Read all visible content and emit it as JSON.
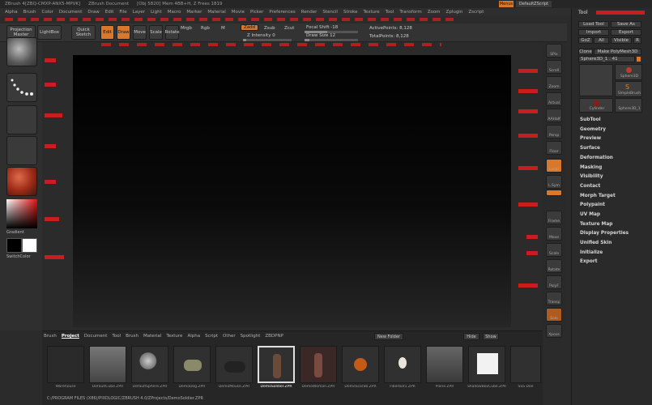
{
  "titlebar": {
    "items": [
      "ZBrush 4[ZBQ-CMXP-ANX5-MPVK]",
      "ZBrush Document",
      "[Obj 5820] Mem 4BB+H, Z Frees 1819"
    ],
    "right": [
      "Menus",
      "DefaultZScript"
    ]
  },
  "menubar": {
    "items": [
      "Alpha",
      "Brush",
      "Color",
      "Document",
      "Draw",
      "Edit",
      "File",
      "Layer",
      "Light",
      "Macro",
      "Marker",
      "Material",
      "Movie",
      "Picker",
      "Preferences",
      "Render",
      "Stencil",
      "Stroke",
      "Texture",
      "Tool",
      "Transform",
      "Zoom",
      "Zplugin",
      "Zscript"
    ]
  },
  "toolbar": {
    "projection_master": "Projection Master",
    "lightbox": "LightBox",
    "quick_sketch": "Quick Sketch",
    "edit": "Edit",
    "draw": "Draw",
    "move": "Move",
    "scale": "Scale",
    "rotate": "Rotate",
    "mrgb": "Mrgb",
    "rgb": "Rgb",
    "m": "M",
    "zadd": "Zadd",
    "zsub": "Zsub",
    "zcut": "Zcut",
    "z_intensity": "Z Intensity 0",
    "focal_shift": "Focal Shift -18",
    "draw_size": "Draw Size 12",
    "active_points": "ActivePoints: 8,128",
    "total_points": "TotalPoints: 8,128"
  },
  "tool_panel": {
    "header": "Tool",
    "buttons": {
      "load_tool": "Load Tool",
      "save_as": "Save As",
      "import": "Import",
      "export": "Export",
      "goz": "GoZ",
      "all": "All",
      "visible": "Visible",
      "r": "R"
    },
    "clone": "Clone",
    "make": "Make PolyMesh3D",
    "current_tool": "Sphere3D_1 . 41",
    "subtools": [
      "Sphere3D",
      "SimpleBrush",
      "Cylinder",
      "Sphere3D_1"
    ],
    "menu": [
      "SubTool",
      "Geometry",
      "Preview",
      "Surface",
      "Deformation",
      "Masking",
      "Visibility",
      "Contact",
      "Morph Target",
      "Polypaint",
      "UV Map",
      "Texture Map",
      "Display Properties",
      "Unified Skin",
      "Initialize",
      "Export"
    ]
  },
  "left_shelf": {
    "gradient": "Gradient",
    "switch_color": "SwitchColor"
  },
  "right_shelf": [
    "SPix",
    "Scroll",
    "Zoom",
    "Actual",
    "AAHalf",
    "Persp",
    "Floor",
    "Local",
    "L.Sym",
    "Frame",
    "Move",
    "Scale",
    "Rotate",
    "PolyF",
    "Transp",
    "Solo",
    "Xpose"
  ],
  "lightbox": {
    "tabs": [
      "Brush",
      "Project",
      "Document",
      "Tool",
      "Brush",
      "Material",
      "Texture",
      "Alpha",
      "Script",
      "Other",
      "Spotlight",
      "ZBDPNP"
    ],
    "new_folder": "New Folder",
    "tools": [
      "Hide",
      "Show"
    ],
    "items": [
      "Warehouse",
      "DefaultCube.ZPR",
      "DefaultSphere.ZPR",
      "DemoDog.ZPR",
      "DemoMouse.ZPR",
      "DemoSoldier.ZPR",
      "DemoWoman.ZPR",
      "DemoScarab.ZPR",
      "Fiberbot1.ZPR",
      "Plane.ZPR",
      "ShadowBoxCube.ZPR",
      "SSS Dee"
    ],
    "path": "C:/PROGRAM FILES (X86)/PIXOLOGIC/ZBRUSH 4.0/ZProjects/DemoSoldier.ZPR"
  },
  "annotations": [
    "红色标注文字",
    "红色标注文字",
    "红色标注文字"
  ],
  "colors": {
    "accent": "#d9772a",
    "annotation": "#ff2a2a",
    "canvas_top": "#000000"
  }
}
